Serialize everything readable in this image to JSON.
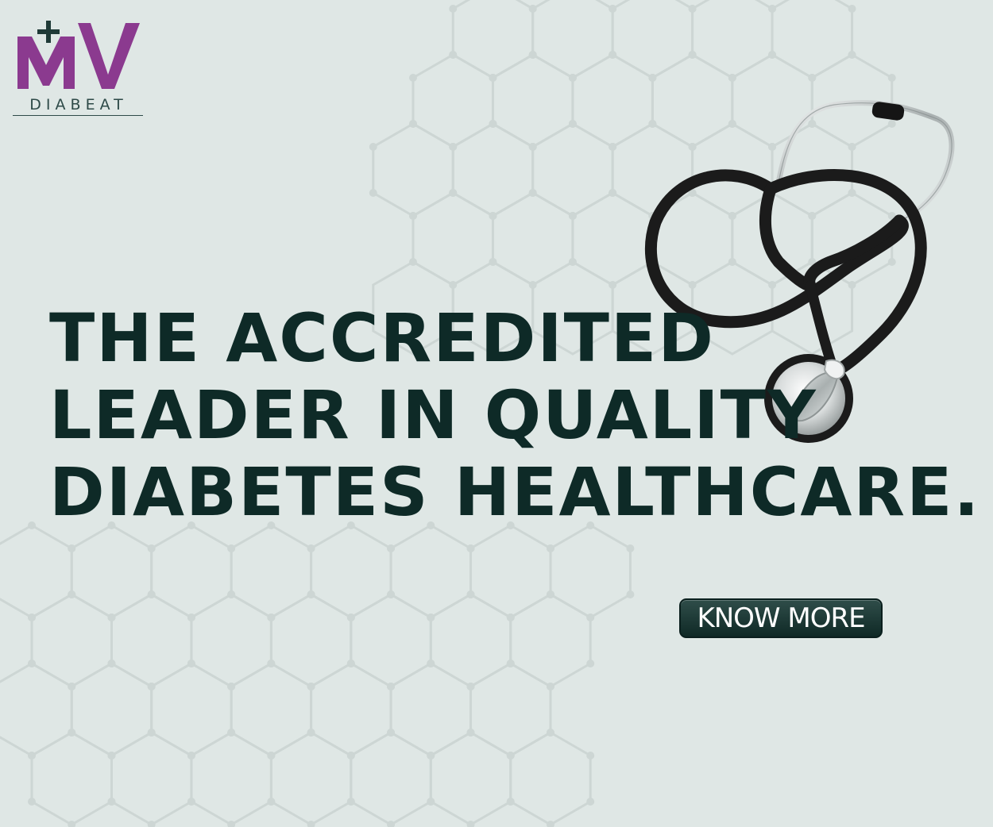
{
  "brand": {
    "logo_letters": "MV",
    "logo_subtitle": "DIABEAT",
    "accent_color": "#8b3a8f"
  },
  "headline": {
    "line1": "THE ACCREDITED",
    "line2": "LEADER IN QUALITY",
    "line3": "DIABETES HEALTHCARE."
  },
  "cta": {
    "label": "KNOW MORE"
  },
  "colors": {
    "background": "#dfe7e5",
    "text": "#0e2a27",
    "button": "#1f3a37"
  }
}
